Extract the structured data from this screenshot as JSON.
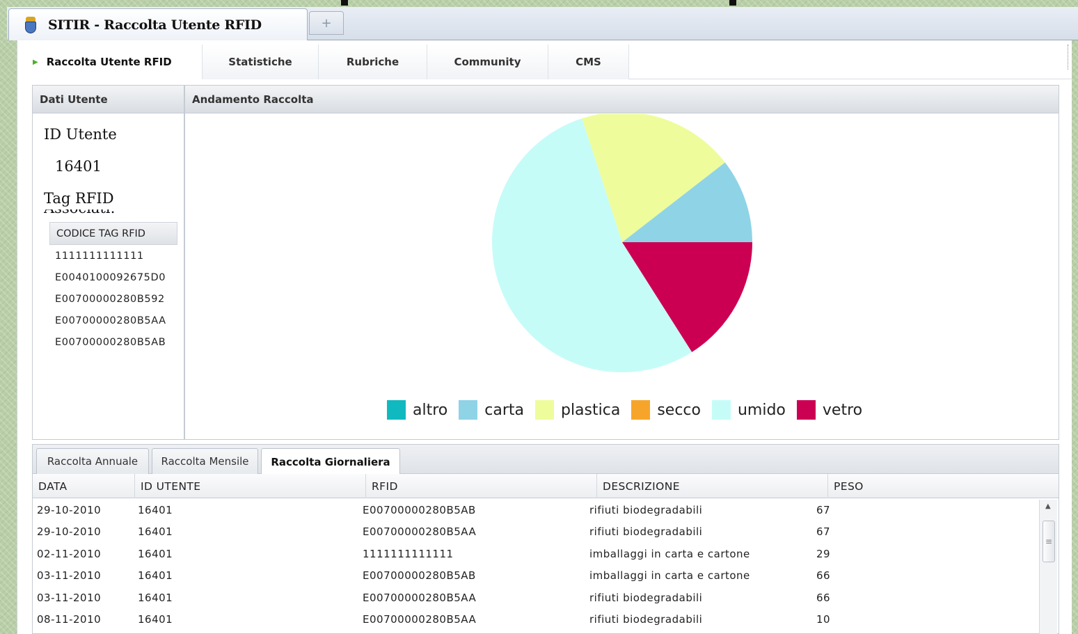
{
  "browser": {
    "tab_title": "SITIR - Raccolta Utente RFID",
    "new_tab_symbol": "+"
  },
  "nav": {
    "items": [
      {
        "label": "Raccolta Utente RFID",
        "active": true
      },
      {
        "label": "Statistiche"
      },
      {
        "label": "Rubriche"
      },
      {
        "label": "Community"
      },
      {
        "label": "CMS"
      }
    ]
  },
  "user_panel": {
    "header": "Dati Utente",
    "id_label": "ID Utente",
    "id_value": "16401",
    "tag_label": "Tag RFID",
    "tag_label_cont": "Associati:",
    "tag_table_header": "CODICE TAG RFID",
    "tags": [
      "1111111111111",
      "E0040100092675D0",
      "E00700000280B592",
      "E00700000280B5AA",
      "E00700000280B5AB"
    ]
  },
  "chart_panel": {
    "header": "Andamento Raccolta"
  },
  "chart_data": {
    "type": "pie",
    "labels": [
      "altro",
      "carta",
      "plastica",
      "secco",
      "umido",
      "vetro"
    ],
    "values": [
      0,
      10.5,
      19.5,
      0,
      54,
      16
    ],
    "colors": [
      "#10b9c0",
      "#8fd3e6",
      "#eefc9b",
      "#f7a52a",
      "#c6fcf8",
      "#cc0052"
    ],
    "legend": "bottom"
  },
  "grid": {
    "tabs": [
      {
        "label": "Raccolta Annuale",
        "active": false
      },
      {
        "label": "Raccolta Mensile",
        "active": false
      },
      {
        "label": "Raccolta Giornaliera",
        "active": true
      }
    ],
    "columns": [
      "DATA",
      "ID UTENTE",
      "RFID",
      "DESCRIZIONE",
      "PESO"
    ],
    "rows": [
      [
        "29-10-2010",
        "16401",
        "E00700000280B5AB",
        "rifiuti biodegradabili",
        "67"
      ],
      [
        "29-10-2010",
        "16401",
        "E00700000280B5AA",
        "rifiuti biodegradabili",
        "67"
      ],
      [
        "02-11-2010",
        "16401",
        "1111111111111",
        "imballaggi in carta e cartone",
        "29"
      ],
      [
        "03-11-2010",
        "16401",
        "E00700000280B5AB",
        "imballaggi in carta e cartone",
        "66"
      ],
      [
        "03-11-2010",
        "16401",
        "E00700000280B5AA",
        "rifiuti biodegradabili",
        "66"
      ],
      [
        "08-11-2010",
        "16401",
        "E00700000280B5AA",
        "rifiuti biodegradabili",
        "10"
      ]
    ]
  }
}
